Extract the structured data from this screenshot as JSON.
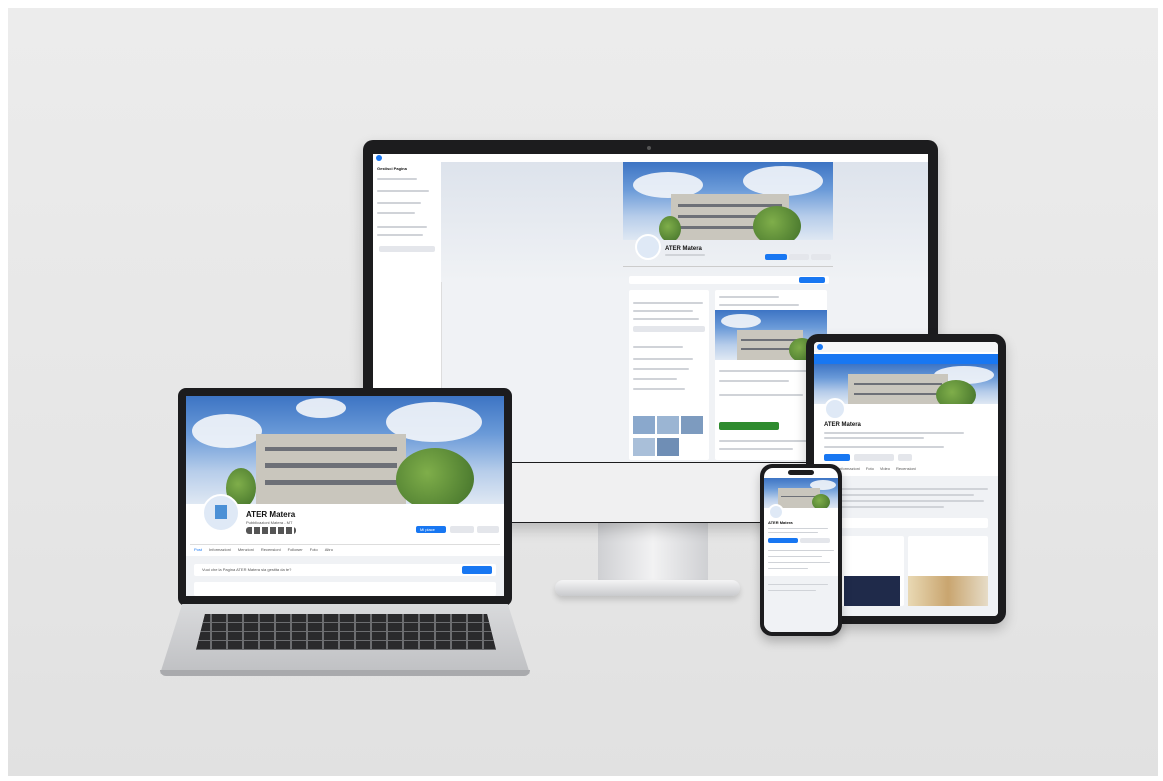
{
  "page_title": "ATER Matera",
  "laptop": {
    "page_name": "ATER Matera",
    "subtitle": "Pubblicazioni Matera - MT",
    "tabs": [
      "Post",
      "Informazioni",
      "Menzioni",
      "Recensioni",
      "Follower",
      "Foto",
      "Altro"
    ],
    "primary_button": "Mi piace",
    "secondary_buttons": [
      "Messaggio",
      "Cerca"
    ],
    "banner_text": "Vuoi che la Pagina ATER Matera sia gestita da te?",
    "banner_button": "Richiedi"
  },
  "monitor": {
    "page_name": "ATER Matera",
    "sidebar_title": "Gestisci Pagina"
  },
  "tablet": {
    "page_name": "ATER Matera",
    "tabs": [
      "Post",
      "Informazioni",
      "Foto",
      "Video",
      "Recensioni"
    ]
  },
  "phone": {
    "page_name": "ATER Matera"
  },
  "colors": {
    "facebook_blue": "#1877f2",
    "device_black": "#1c1c1e",
    "laptop_silver": "#c8c9cc"
  }
}
